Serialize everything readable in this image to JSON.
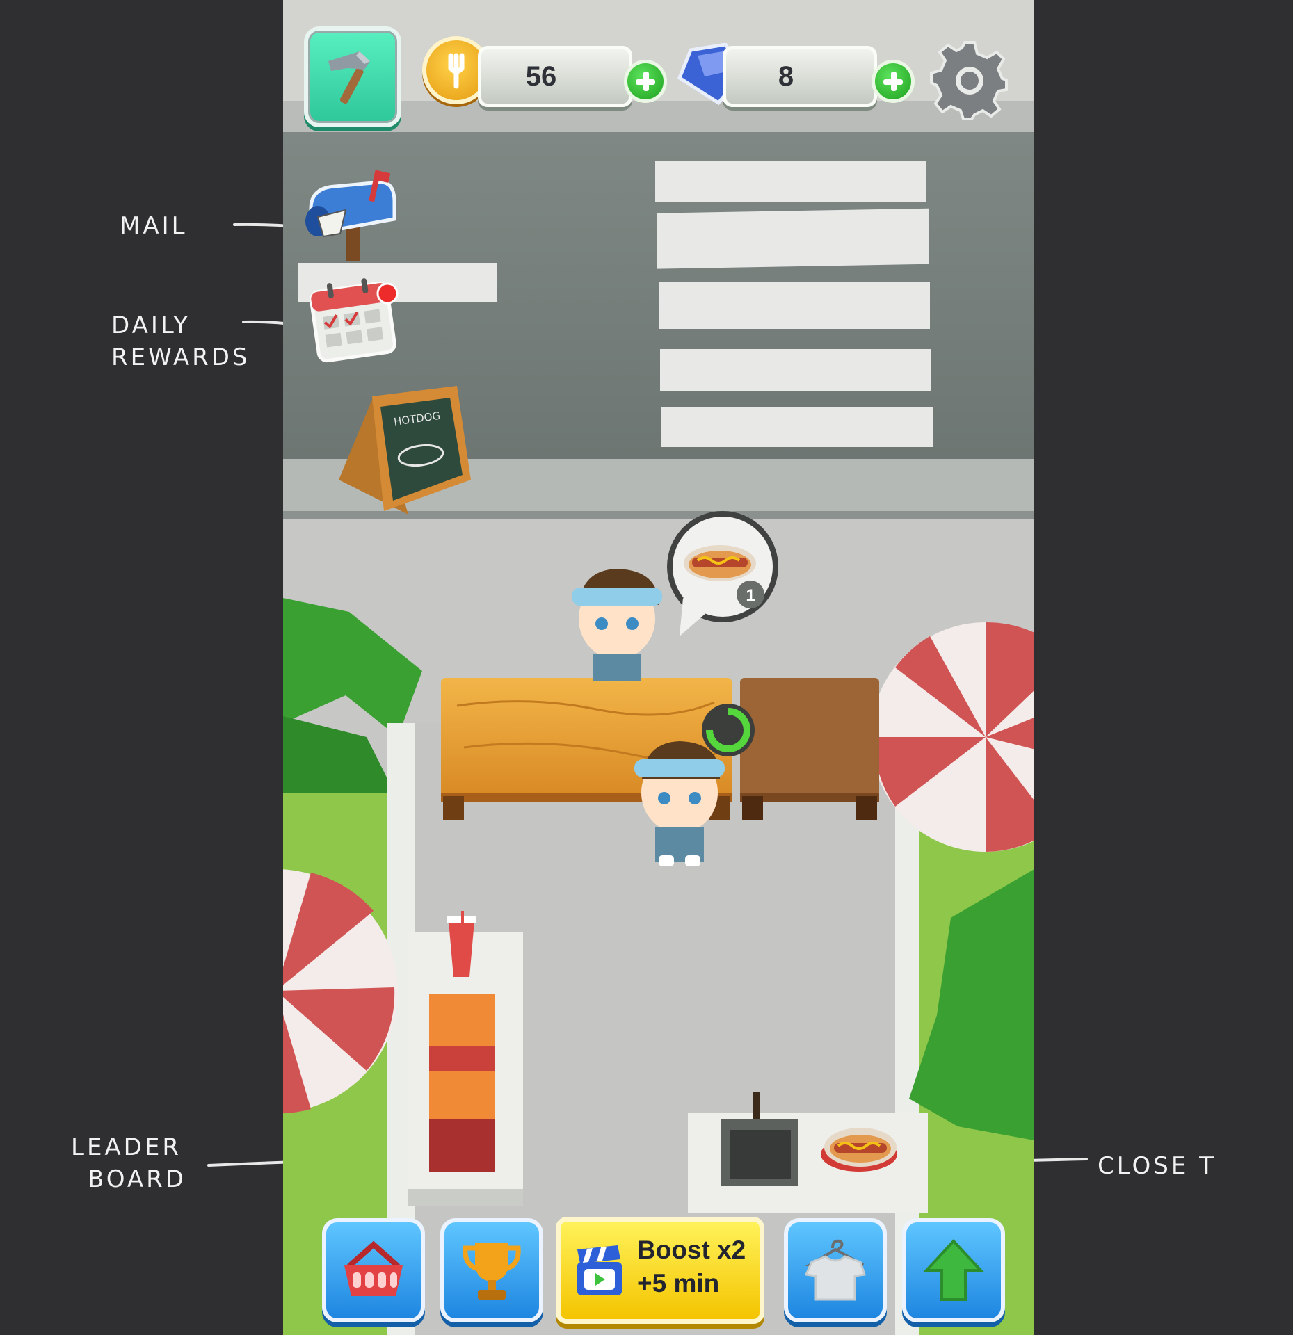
{
  "hud": {
    "coins": "56",
    "gems": "8",
    "icons": {
      "build": "hammer-icon",
      "coin": "coin-icon",
      "gem": "gem-icon",
      "add": "plus-icon",
      "settings": "gear-icon"
    }
  },
  "side_buttons": {
    "mail": "mailbox-icon",
    "daily_rewards": "calendar-icon",
    "daily_rewards_badge": "notification-dot"
  },
  "scene": {
    "sign_text": "HOTDOG",
    "order_count": "1",
    "order_item": "hotdog-icon"
  },
  "bottom_bar": {
    "shop": "basket-icon",
    "leaderboard": "trophy-icon",
    "boost_line1": "Boost x2",
    "boost_line2": "+5 min",
    "boost_icon": "video-clapper-icon",
    "closet": "shirt-icon",
    "upgrade": "up-arrow-icon"
  },
  "annotations": {
    "mail": "MAIL",
    "daily_line1": "DAILY",
    "daily_line2": "REWARDS",
    "leader_line1": "LEADER",
    "leader_line2": "BOARD",
    "closet": "CLOSE T"
  },
  "colors": {
    "background": "#2f2f31",
    "build_button": "#3fdcae",
    "bottom_buttons": "#2b9bf0",
    "boost_button": "#ffe01a",
    "plus_button": "#2fbf2f"
  }
}
